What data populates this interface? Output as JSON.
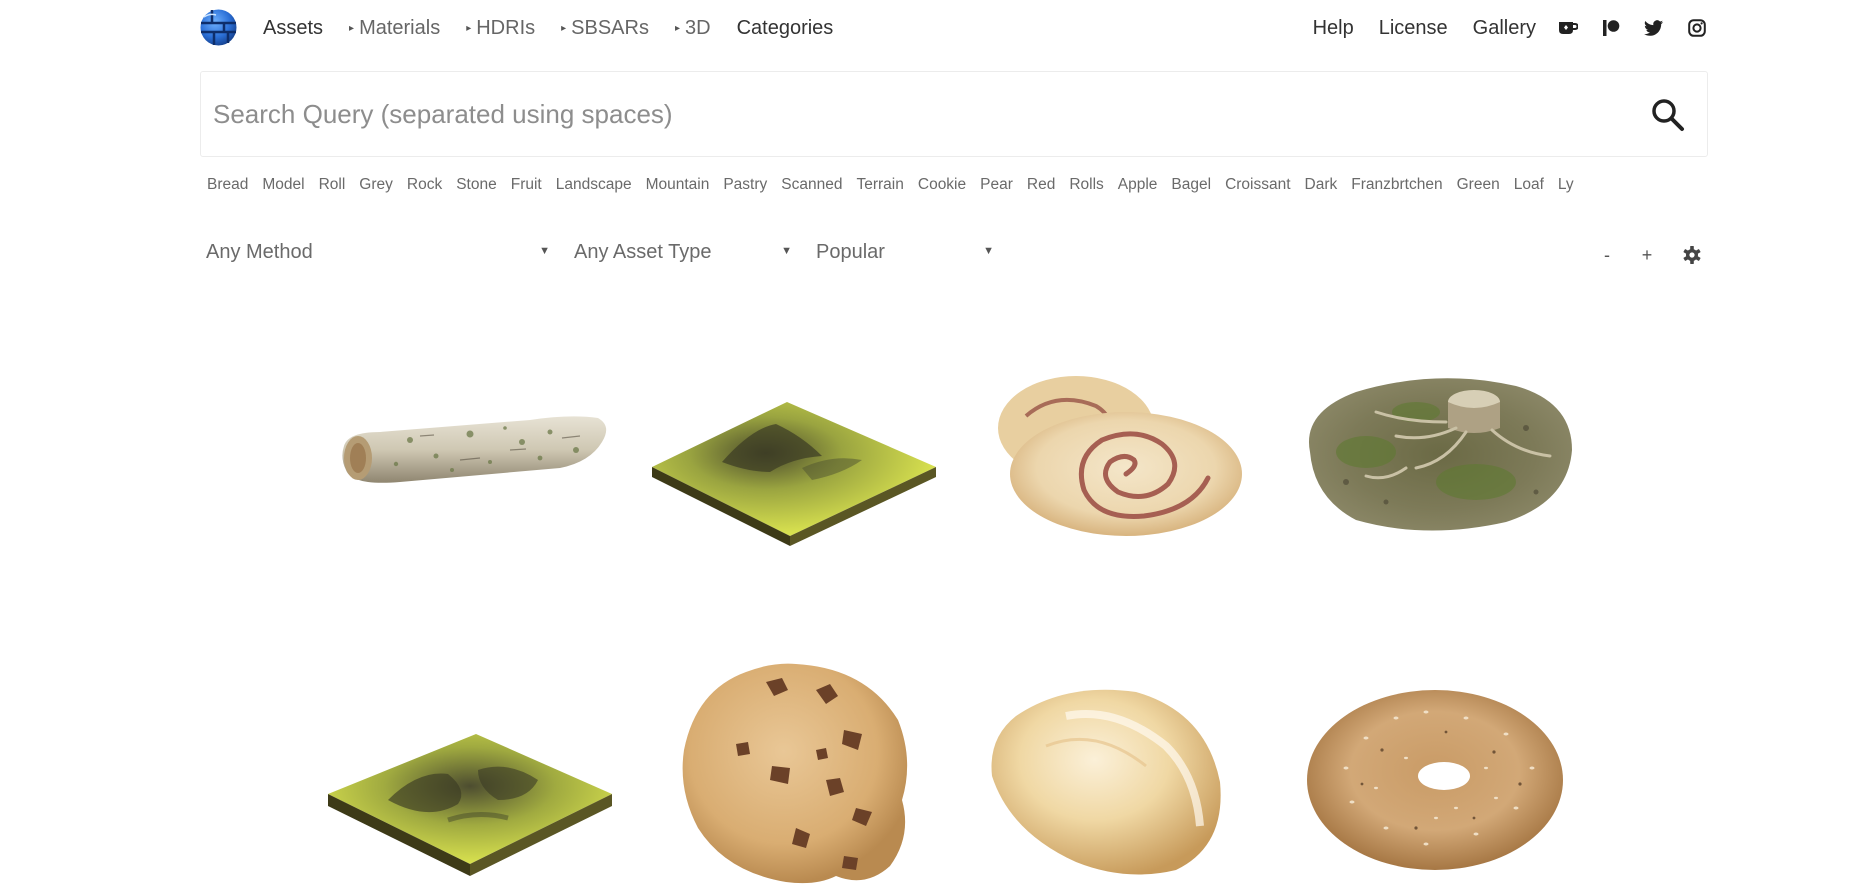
{
  "nav": {
    "logo_icon": "globe-logo-icon",
    "assets": "Assets",
    "materials": "Materials",
    "hdris": "HDRIs",
    "sbsars": "SBSARs",
    "threed": "3D",
    "categories": "Categories",
    "help": "Help",
    "license": "License",
    "gallery": "Gallery",
    "social": [
      "ko-fi-icon",
      "patreon-icon",
      "twitter-icon",
      "instagram-icon"
    ]
  },
  "search": {
    "placeholder": "Search Query (separated using spaces)",
    "value": "",
    "button_icon": "search-icon"
  },
  "tags": [
    "Bread",
    "Model",
    "Roll",
    "Grey",
    "Rock",
    "Stone",
    "Fruit",
    "Landscape",
    "Mountain",
    "Pastry",
    "Scanned",
    "Terrain",
    "Cookie",
    "Pear",
    "Red",
    "Rolls",
    "Apple",
    "Bagel",
    "Croissant",
    "Dark",
    "Franzbrtchen",
    "Green",
    "Loaf",
    "Ly"
  ],
  "filters": {
    "method": "Any Method",
    "asset_type": "Any Asset Type",
    "sort": "Popular",
    "zoom_out": "-",
    "zoom_in": "+",
    "settings_icon": "gear-icon"
  },
  "assets": [
    {
      "kind": "log",
      "thumbnail": "birch-log-thumbnail"
    },
    {
      "kind": "terrain",
      "thumbnail": "mountain-terrain-thumbnail"
    },
    {
      "kind": "roll",
      "thumbnail": "cinnamon-roll-thumbnail"
    },
    {
      "kind": "ground",
      "thumbnail": "forest-ground-stump-thumbnail"
    },
    {
      "kind": "terrain",
      "thumbnail": "terrain-ridges-thumbnail"
    },
    {
      "kind": "cookie",
      "thumbnail": "chocolate-chip-cookie-thumbnail"
    },
    {
      "kind": "bread",
      "thumbnail": "bread-roll-thumbnail"
    },
    {
      "kind": "bagel",
      "thumbnail": "sesame-bagel-thumbnail"
    }
  ],
  "colors": {
    "nav_text": "#333333",
    "muted_text": "#6a6a6a",
    "logo_blue": "#2b6fd6",
    "border": "#ececec"
  }
}
